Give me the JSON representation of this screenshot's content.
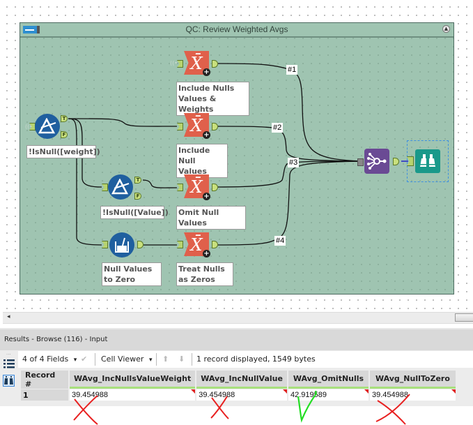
{
  "canvas": {
    "container": {
      "title": "QC: Review Weighted Avgs",
      "toggle_icon": "container-toggle-icon",
      "collapse_icon": "collapse-up-icon",
      "background": "#9fc4b1"
    },
    "tools": [
      {
        "id": "filter-weight",
        "type": "filter",
        "icon": "filter-prism-icon",
        "annotation": "!IsNull([weight])",
        "anchors": [
          "T",
          "F"
        ]
      },
      {
        "id": "avg-include-nulls-values-weights",
        "type": "weighted-average",
        "icon": "x-bar-icon",
        "glyph": "X̄",
        "annotation": "Include Nulls Values & Weights"
      },
      {
        "id": "avg-include-null-values",
        "type": "weighted-average",
        "icon": "x-bar-icon",
        "glyph": "X̄",
        "annotation": "Include Null Values"
      },
      {
        "id": "filter-value",
        "type": "filter",
        "icon": "filter-prism-icon",
        "annotation": "!IsNull([Value])",
        "anchors": [
          "T",
          "F"
        ]
      },
      {
        "id": "avg-omit-null-values",
        "type": "weighted-average",
        "icon": "x-bar-icon",
        "glyph": "X̄",
        "annotation": "Omit Null Values"
      },
      {
        "id": "formula-null-to-zero",
        "type": "formula",
        "icon": "formula-beaker-icon",
        "annotation": "Null Values to Zero"
      },
      {
        "id": "avg-treat-nulls-zeros",
        "type": "weighted-average",
        "icon": "x-bar-icon",
        "glyph": "X̄",
        "annotation": "Treat Nulls as Zeros"
      },
      {
        "id": "union",
        "type": "union",
        "icon": "union-icon"
      },
      {
        "id": "browse",
        "type": "browse",
        "icon": "binoculars-icon",
        "selected": true
      }
    ],
    "connection_labels": [
      "#1",
      "#2",
      "#3",
      "#4"
    ],
    "anchor_labels": {
      "true": "T",
      "false": "F"
    }
  },
  "scrollbar": {
    "left_arrow": "◂"
  },
  "results": {
    "title": "Results - Browse (116) - Input",
    "toolbar": {
      "fields_selector": "4 of 4 Fields",
      "cell_viewer": "Cell Viewer",
      "record_info": "1 record displayed, 1549 bytes",
      "up_arrow": "⬆",
      "down_arrow": "⬇",
      "check": "✔",
      "dropdown": "▾"
    },
    "table": {
      "columns": [
        "Record #",
        "WAvg_IncNullsValueWeight",
        "WAvg_IncNullValue",
        "WAvg_OmitNulls",
        "WAvg_NullToZero"
      ],
      "rows": [
        {
          "record": "1",
          "values": [
            "39.454988",
            "39.454988",
            "42.919589",
            "39.454988"
          ]
        }
      ]
    },
    "annotations": [
      {
        "column": "WAvg_IncNullsValueWeight",
        "mark": "cross",
        "color": "#e82020"
      },
      {
        "column": "WAvg_IncNullValue",
        "mark": "cross",
        "color": "#e82020"
      },
      {
        "column": "WAvg_OmitNulls",
        "mark": "check",
        "color": "#22dd22"
      },
      {
        "column": "WAvg_NullToZero",
        "mark": "cross",
        "color": "#e82020"
      }
    ]
  }
}
